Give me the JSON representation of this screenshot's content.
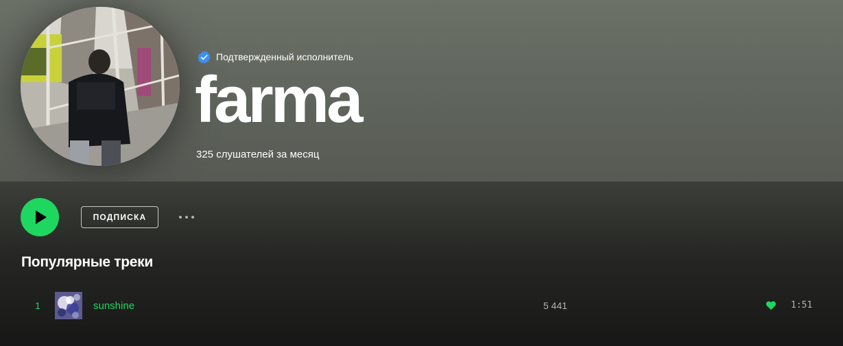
{
  "colors": {
    "accent": "#1ed760",
    "header_bg": "#6c7168",
    "background": "#121212",
    "verified_blue": "#3d91f4",
    "text_muted": "#b3b3b3"
  },
  "artist": {
    "verified_label": "Подтвержденный исполнитель",
    "name": "farma",
    "monthly_listeners": "325 слушателей за месяц",
    "avatar_icon": "artist-photo"
  },
  "actions": {
    "play_icon": "play-icon",
    "follow_label": "ПОДПИСКА",
    "more_icon": "more-options-icon"
  },
  "popular": {
    "title": "Популярные треки",
    "tracks": [
      {
        "number": "1",
        "title": "sunshine",
        "plays": "5 441",
        "liked": true,
        "duration": "1:51"
      }
    ]
  }
}
